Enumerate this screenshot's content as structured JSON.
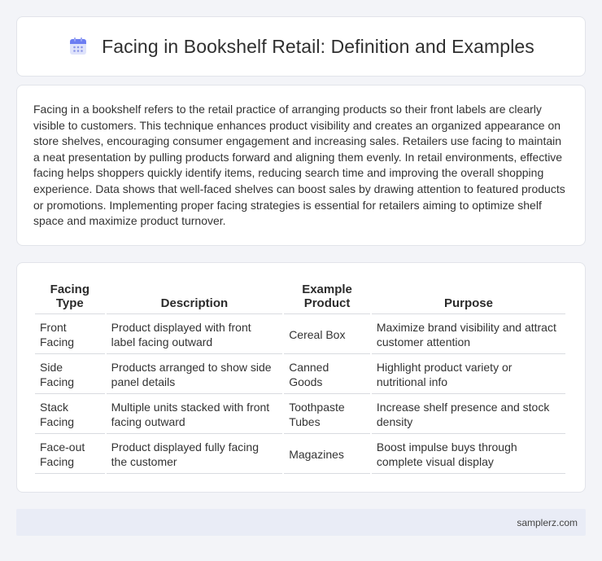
{
  "header": {
    "icon": "calendar-icon",
    "title": "Facing in Bookshelf Retail: Definition and Examples"
  },
  "intro": {
    "text": "Facing in a bookshelf refers to the retail practice of arranging products so their front labels are clearly visible to customers. This technique enhances product visibility and creates an organized appearance on store shelves, encouraging consumer engagement and increasing sales. Retailers use facing to maintain a neat presentation by pulling products forward and aligning them evenly. In retail environments, effective facing helps shoppers quickly identify items, reducing search time and improving the overall shopping experience. Data shows that well-faced shelves can boost sales by drawing attention to featured products or promotions. Implementing proper facing strategies is essential for retailers aiming to optimize shelf space and maximize product turnover."
  },
  "table": {
    "headers": [
      "Facing Type",
      "Description",
      "Example Product",
      "Purpose"
    ],
    "rows": [
      [
        "Front Facing",
        "Product displayed with front label facing outward",
        "Cereal Box",
        "Maximize brand visibility and attract customer attention"
      ],
      [
        "Side Facing",
        "Products arranged to show side panel details",
        "Canned Goods",
        "Highlight product variety or nutritional info"
      ],
      [
        "Stack Facing",
        "Multiple units stacked with front facing outward",
        "Toothpaste Tubes",
        "Increase shelf presence and stock density"
      ],
      [
        "Face-out Facing",
        "Product displayed fully facing the customer",
        "Magazines",
        "Boost impulse buys through complete visual display"
      ]
    ]
  },
  "footer": {
    "site": "samplerz.com"
  }
}
